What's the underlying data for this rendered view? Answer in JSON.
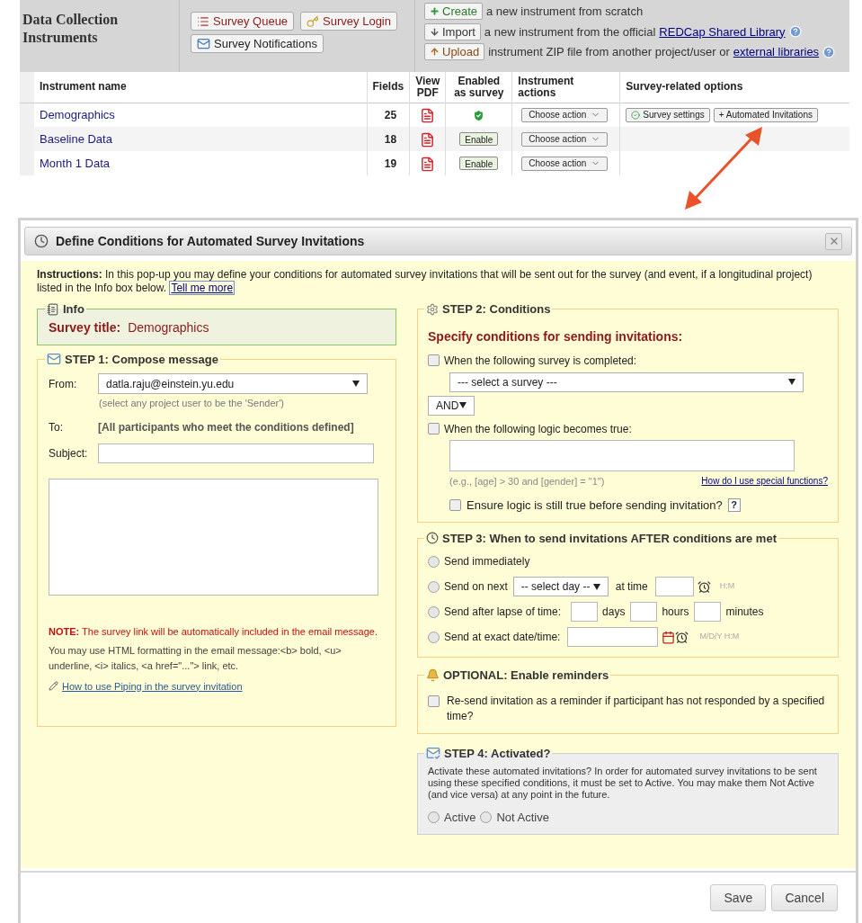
{
  "header": {
    "title": "Data Collection Instruments",
    "survey_buttons": [
      {
        "kind": "queue",
        "label": "Survey Queue"
      },
      {
        "kind": "login",
        "label": "Survey Login"
      },
      {
        "kind": "notifications",
        "label": "Survey Notifications"
      }
    ],
    "create_actions": [
      {
        "kind": "create",
        "button": "Create",
        "text": "a new instrument from scratch"
      },
      {
        "kind": "import",
        "button": "Import",
        "text": "a new instrument from the official",
        "link": "REDCap Shared Library"
      },
      {
        "kind": "upload",
        "button": "Upload",
        "text": "instrument ZIP file from another project/user or",
        "link": "external libraries"
      }
    ]
  },
  "table": {
    "columns": [
      "Instrument name",
      "Fields",
      "View PDF",
      "Enabled as survey",
      "Instrument actions",
      "Survey-related options"
    ],
    "rows": [
      {
        "name": "Demographics",
        "fields": "25",
        "survey_enabled": true,
        "action": "Choose action",
        "options": [
          {
            "kind": "settings",
            "label": "Survey settings"
          },
          {
            "kind": "plain",
            "label": "+ Automated Invitations"
          }
        ]
      },
      {
        "name": "Baseline Data",
        "fields": "18",
        "survey_enabled": false,
        "enable_label": "Enable",
        "action": "Choose action"
      },
      {
        "name": "Month 1 Data",
        "fields": "19",
        "survey_enabled": false,
        "enable_label": "Enable",
        "action": "Choose action"
      }
    ]
  },
  "dialog": {
    "title": "Define Conditions for Automated Survey Invitations",
    "instructions": "**Instructions:** In this pop-up you may define your conditions for automated survey invitations that will be sent out for the survey (and event, if a longitudinal project) listed in the Info box below.",
    "instructions_link": "Tell me more",
    "info": {
      "legend": "Info",
      "label": "Survey title:",
      "value": "Demographics"
    },
    "step1": {
      "legend": "STEP 1: Compose message",
      "from_label": "From:",
      "from_value": "datla.raju@einstein.yu.edu",
      "from_hint": "(select any project user to be the 'Sender')",
      "to_label": "To:",
      "to_value": "[All participants who meet the conditions defined]",
      "subject_label": "Subject:",
      "note": "**NOTE:** The survey link will be automatically included in the email message.",
      "html_hint": "You may use HTML formatting in the email message:<b> bold, <u> underline, <i> italics, <a href=\"...\"> link, etc.",
      "piping_link": "How to use Piping in the survey invitation"
    },
    "step2": {
      "legend": "STEP 2: Conditions",
      "heading": "Specify conditions for sending invitations:",
      "survey_completed": {
        "label": "When the following survey is completed:",
        "checked": false
      },
      "survey_select": "--- select a survey ---",
      "operator": "AND",
      "logic": {
        "label": "When the following logic becomes true:",
        "checked": false
      },
      "example": "(e.g., [age] > 30 and [gender] = \"1\")",
      "functions_link": "How do I use special functions?",
      "ensure": {
        "label": "Ensure logic is still true before sending invitation?",
        "checked": false
      },
      "help": "?"
    },
    "step3": {
      "legend": "STEP 3: When to send invitations AFTER conditions are met",
      "options": [
        {
          "kind": "plain",
          "label": "Send immediately",
          "selected": false
        },
        {
          "kind": "next_day",
          "label": "Send on next",
          "select": "-- select day --",
          "at": "at time",
          "hint": "H:M",
          "selected": false
        },
        {
          "kind": "lapse",
          "label": "Send after lapse of time:",
          "units": [
            "days",
            "hours",
            "minutes"
          ],
          "selected": false
        },
        {
          "kind": "exact",
          "label": "Send at exact date/time:",
          "hint": "M/D/Y H:M",
          "selected": false
        }
      ]
    },
    "reminders": {
      "legend": "OPTIONAL: Enable reminders",
      "label": "Re-send invitation as a reminder if participant has not responded by a specified time?",
      "checked": false
    },
    "step4": {
      "legend": "STEP 4: Activated?",
      "text": "Activate these automated invitations? In order for automated survey invitations to be sent using these specified conditions, it must be set to Active. You may make them Not Active (and vice versa) at any point in the future.",
      "options": [
        {
          "label": "Active",
          "selected": false
        },
        {
          "label": "Not Active",
          "selected": false
        }
      ]
    },
    "buttons": [
      "Save",
      "Cancel"
    ]
  }
}
